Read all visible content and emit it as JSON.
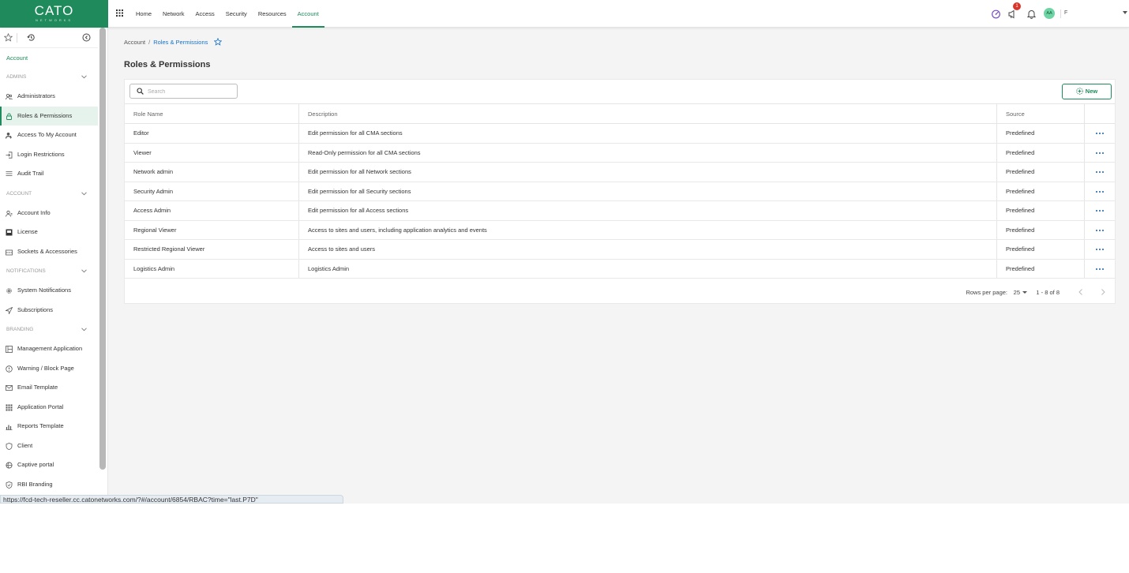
{
  "brand": {
    "logo_text": "CATO",
    "logo_sub": "NETWORKS",
    "accent_color": "#1f8a5b"
  },
  "topnav": {
    "items": [
      {
        "label": "Home"
      },
      {
        "label": "Network"
      },
      {
        "label": "Access"
      },
      {
        "label": "Security"
      },
      {
        "label": "Resources"
      },
      {
        "label": "Account",
        "active": true
      }
    ]
  },
  "topright": {
    "notification_count": "1",
    "avatar_initials": "AA",
    "user_name": "F",
    "icons": [
      "speed-icon",
      "announcement-icon",
      "bell-icon",
      "chevron-down-icon"
    ]
  },
  "sidebar": {
    "account_label": "Account",
    "sections": [
      {
        "title": "ADMINS",
        "items": [
          {
            "label": "Administrators",
            "icon": "admins-icon"
          },
          {
            "label": "Roles & Permissions",
            "icon": "lock-icon",
            "active": true
          },
          {
            "label": "Access To My Account",
            "icon": "user-key-icon"
          },
          {
            "label": "Login Restrictions",
            "icon": "login-icon"
          },
          {
            "label": "Audit Trail",
            "icon": "list-icon"
          }
        ]
      },
      {
        "title": "ACCOUNT",
        "items": [
          {
            "label": "Account Info",
            "icon": "account-info-icon"
          },
          {
            "label": "License",
            "icon": "license-icon"
          },
          {
            "label": "Sockets & Accessories",
            "icon": "socket-icon"
          }
        ]
      },
      {
        "title": "NOTIFICATIONS",
        "items": [
          {
            "label": "System Notifications",
            "icon": "gear-icon"
          },
          {
            "label": "Subscriptions",
            "icon": "send-icon"
          }
        ]
      },
      {
        "title": "BRANDING",
        "items": [
          {
            "label": "Management Application",
            "icon": "app-icon"
          },
          {
            "label": "Warning / Block Page",
            "icon": "warning-icon"
          },
          {
            "label": "Email Template",
            "icon": "email-icon"
          },
          {
            "label": "Application Portal",
            "icon": "grid-icon"
          },
          {
            "label": "Reports Template",
            "icon": "chart-icon"
          },
          {
            "label": "Client",
            "icon": "shield-icon"
          },
          {
            "label": "Captive portal",
            "icon": "portal-icon"
          },
          {
            "label": "RBI Branding",
            "icon": "rbi-icon"
          }
        ]
      }
    ]
  },
  "breadcrumb": {
    "root": "Account",
    "separator": "/",
    "current": "Roles & Permissions"
  },
  "page_title": "Roles & Permissions",
  "search": {
    "placeholder": "Search",
    "value": ""
  },
  "new_button": {
    "label": "New"
  },
  "table": {
    "columns": {
      "name": "Role Name",
      "description": "Description",
      "source": "Source"
    },
    "rows": [
      {
        "name": "Editor",
        "description": "Edit permission for all CMA sections",
        "source": "Predefined"
      },
      {
        "name": "Viewer",
        "description": "Read-Only permission for all CMA sections",
        "source": "Predefined"
      },
      {
        "name": "Network admin",
        "description": "Edit permission for all Network sections",
        "source": "Predefined"
      },
      {
        "name": "Security Admin",
        "description": "Edit permission for all Security sections",
        "source": "Predefined"
      },
      {
        "name": "Access Admin",
        "description": "Edit permission for all Access sections",
        "source": "Predefined"
      },
      {
        "name": "Regional Viewer",
        "description": "Access to sites and users, including application analytics and events",
        "source": "Predefined"
      },
      {
        "name": "Restricted Regional Viewer",
        "description": "Access to sites and users",
        "source": "Predefined"
      },
      {
        "name": "Logistics Admin",
        "description": "Logistics Admin",
        "source": "Predefined"
      }
    ]
  },
  "pagination": {
    "rows_per_page_label": "Rows per page:",
    "rows_per_page": "25",
    "range": "1 - 8 of 8"
  },
  "status_url": "https://fcd-tech-reseller.cc.catonetworks.com/?#/account/6854/RBAC?time=\"last.P7D\""
}
